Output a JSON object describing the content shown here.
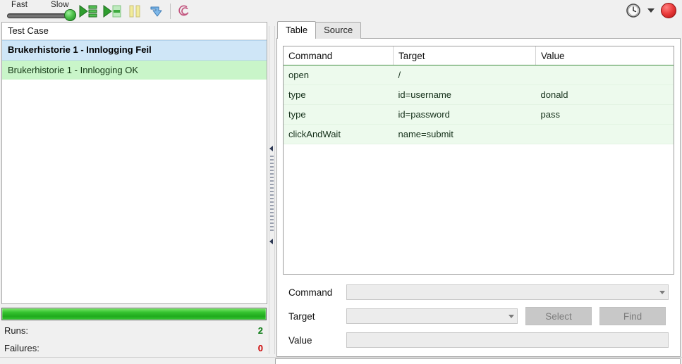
{
  "toolbar": {
    "speed": {
      "fast_label": "Fast",
      "slow_label": "Slow",
      "thumb_position": "slow"
    },
    "buttons": [
      {
        "name": "run-all-tests-button",
        "icon": "play-list-icon",
        "label": "Run all tests"
      },
      {
        "name": "run-current-test-button",
        "icon": "play-single-icon",
        "label": "Run current test"
      },
      {
        "name": "pause-button",
        "icon": "pause-icon",
        "label": "Pause"
      },
      {
        "name": "step-button",
        "icon": "step-arrow-icon",
        "label": "Step"
      },
      {
        "name": "rollup-button",
        "icon": "spiral-icon",
        "label": "Apply rollup rules"
      }
    ],
    "right": {
      "schedule_icon": "clock-icon",
      "dropdown_icon": "chevron-down-icon",
      "record_button": "record-icon"
    }
  },
  "left_panel": {
    "header": "Test Case",
    "test_cases": [
      {
        "name": "Brukerhistorie 1 - Innlogging Feil",
        "state": "selected"
      },
      {
        "name": "Brukerhistorie 1 - Innlogging OK",
        "state": "passed"
      }
    ],
    "progress": {
      "percent": 100,
      "color": "#2cbd28"
    },
    "stats": [
      {
        "label": "Runs:",
        "value": "2",
        "color": "#0a7a12"
      },
      {
        "label": "Failures:",
        "value": "0",
        "color": "#cc0000"
      }
    ]
  },
  "right_panel": {
    "tabs": [
      {
        "label": "Table",
        "active": true
      },
      {
        "label": "Source",
        "active": false
      }
    ],
    "table": {
      "columns": [
        "Command",
        "Target",
        "Value"
      ],
      "rows": [
        {
          "command": "open",
          "target": "/",
          "value": ""
        },
        {
          "command": "type",
          "target": "id=username",
          "value": "donald"
        },
        {
          "command": "type",
          "target": "id=password",
          "value": "pass"
        },
        {
          "command": "clickAndWait",
          "target": "name=submit",
          "value": ""
        }
      ]
    },
    "editor": {
      "command_label": "Command",
      "command_value": "",
      "target_label": "Target",
      "target_value": "",
      "value_label": "Value",
      "value_value": "",
      "select_button": "Select",
      "find_button": "Find"
    }
  }
}
